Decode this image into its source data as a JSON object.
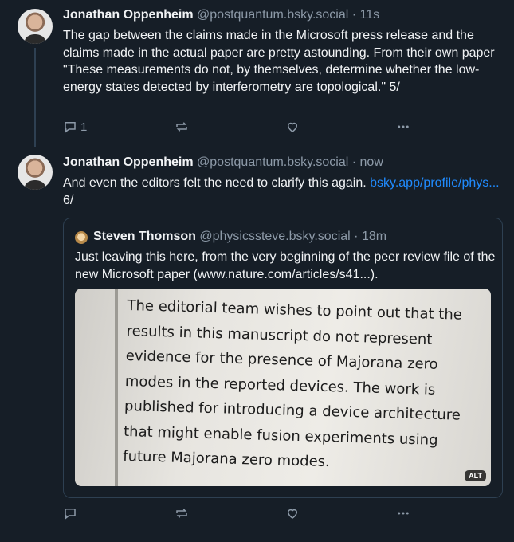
{
  "posts": [
    {
      "author_name": "Jonathan Oppenheim",
      "handle": "@postquantum.bsky.social",
      "separator": "·",
      "time": "11s",
      "text": "The gap between the claims made in the Microsoft press release and the claims made in the actual paper are pretty astounding. From their own paper \"These measurements do not, by themselves, determine whether the low-energy states detected by interferometry are topological.\" 5/",
      "reply_count": "1"
    },
    {
      "author_name": "Jonathan Oppenheim",
      "handle": "@postquantum.bsky.social",
      "separator": "·",
      "time": "now",
      "text_before_link": "And even the editors felt the need to clarify this again. ",
      "link_text": "bsky.app/profile/phys...",
      "text_after_link": " 6/",
      "reply_count": "",
      "quote": {
        "author_name": "Steven Thomson",
        "handle": "@physicssteve.bsky.social",
        "separator": "·",
        "time": "18m",
        "text": "Just leaving this here, from the very beginning of the peer review file of the new Microsoft paper (www.nature.com/articles/s41...).",
        "image_lines": [
          "The editorial team wishes to point out that the",
          "results in this manuscript do not represent",
          "evidence for the presence of Majorana zero",
          "modes in the reported devices. The work is",
          "published for introducing a device architecture",
          "that might enable fusion experiments using",
          "future Majorana zero modes."
        ],
        "alt_badge": "ALT"
      }
    }
  ],
  "icons": [
    "reply-icon",
    "repost-icon",
    "like-icon",
    "more-icon"
  ],
  "colors": {
    "background": "#161e27",
    "text": "#f1f3f5",
    "muted": "#8d9aa8",
    "link": "#208bfe",
    "border": "#2e4052"
  }
}
